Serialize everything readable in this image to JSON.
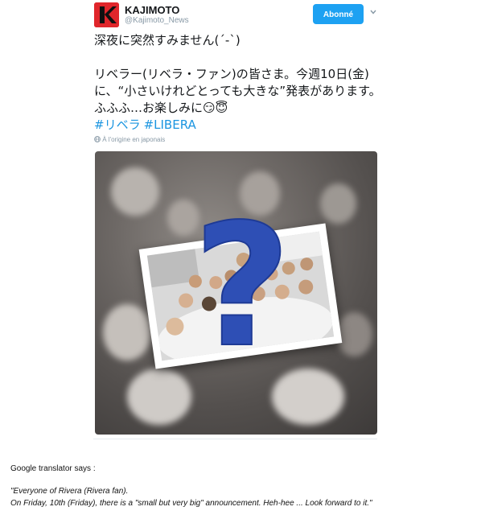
{
  "tweet": {
    "author_name": "KAJIMOTO",
    "author_handle": "@Kajimoto_News",
    "follow_label": "Abonné",
    "line1": "深夜に突然すみません(´-`)",
    "line2": "リベラー(リベラ・ファン)の皆さま。今週10日(金)",
    "line3": "に、“小さいけれどとっても大きな”発表があります。",
    "line4": "ふふふ…お楽しみに😏😇",
    "hashtags": [
      "#リベラ",
      "#LIBERA"
    ],
    "translate_note": "À l'origine en japonais",
    "media_symbol": "?"
  },
  "icons": {
    "avatar": "kajimoto-k-logo",
    "caret": "chevron-down-icon",
    "globe": "globe-icon"
  },
  "colors": {
    "accent": "#1da1f2",
    "hashtag": "#1b95e0",
    "logo": "#e0262b",
    "question_mark": "#2e4fb5"
  },
  "footer": {
    "heading": "Google translator says :",
    "quote1": "\"Everyone of Rivera (Rivera fan).",
    "quote2": "On Friday, 10th (Friday), there is a \"small but very big\" announcement. Heh-hee ... Look forward to it.\""
  }
}
